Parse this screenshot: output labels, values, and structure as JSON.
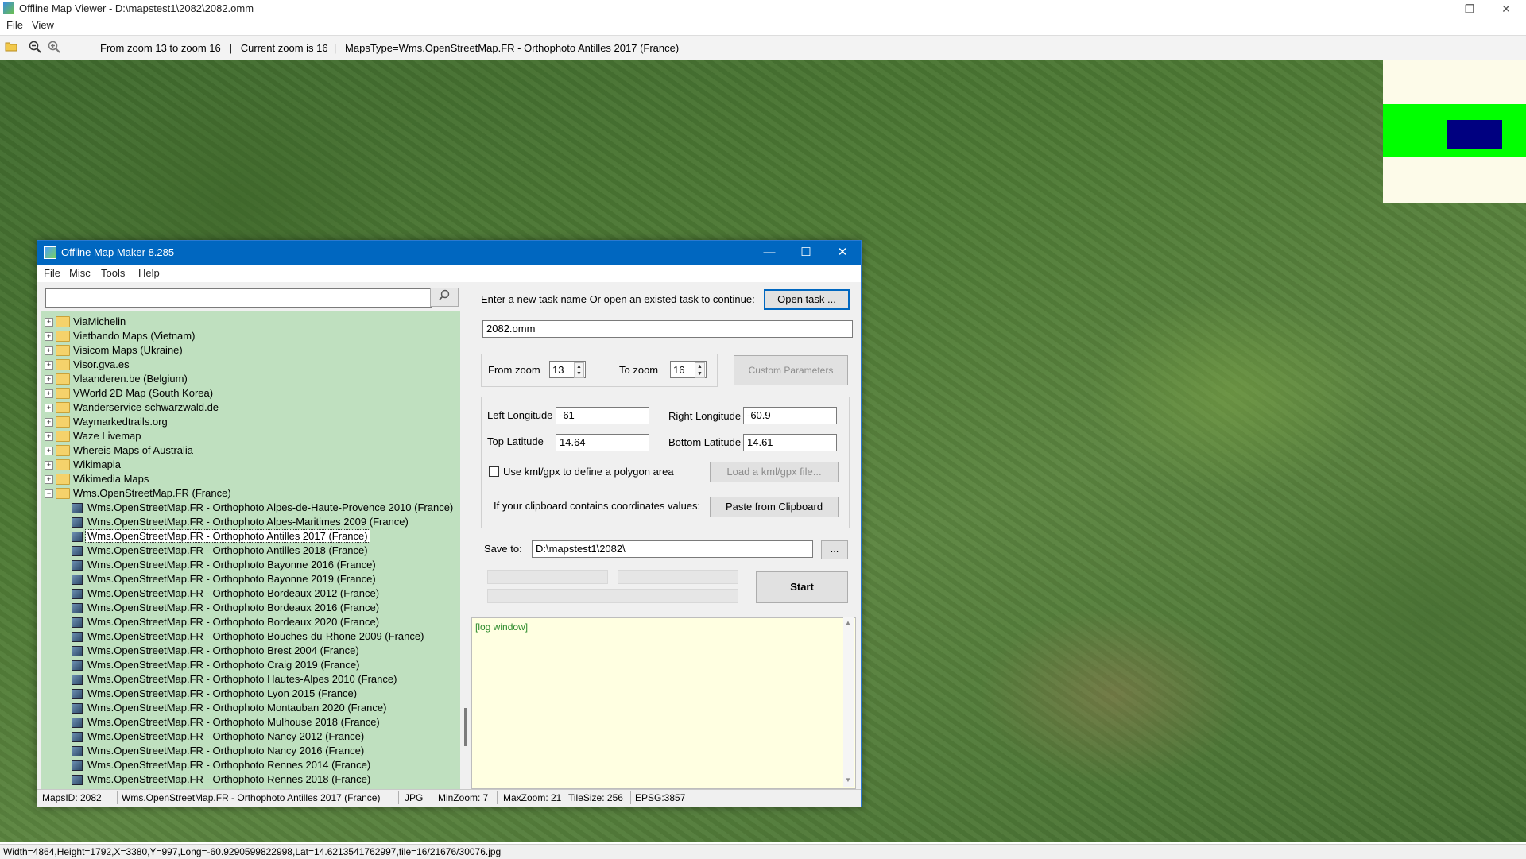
{
  "app": {
    "title": "Offline Map Viewer - D:\\mapstest1\\2082\\2082.omm",
    "menu": [
      "File",
      "View"
    ],
    "toolbar_info": "From zoom 13 to zoom 16   |   Current zoom is 16  |   MapsType=Wms.OpenStreetMap.FR - Orthophoto Antilles 2017 (France)",
    "status": "Width=4864,Height=1792,X=3380,Y=997,Long=-60.9290599822998,Lat=14.6213541762997,file=16/21676/30076.jpg",
    "overview_colors": {
      "background": "#fdfbe9",
      "band": "#00ff00",
      "viewport": "#000080"
    }
  },
  "dialog": {
    "title": "Offline Map Maker 8.285",
    "menu": [
      "File",
      "Misc",
      "Tools",
      "Help"
    ],
    "search": {
      "value": "",
      "placeholder": ""
    },
    "tree": [
      {
        "label": "ViaMichelin",
        "type": "folder",
        "level": 0,
        "expanded": false
      },
      {
        "label": "Vietbando Maps (Vietnam)",
        "type": "folder",
        "level": 0,
        "expanded": false
      },
      {
        "label": "Visicom Maps (Ukraine)",
        "type": "folder",
        "level": 0,
        "expanded": false
      },
      {
        "label": "Visor.gva.es",
        "type": "folder",
        "level": 0,
        "expanded": false
      },
      {
        "label": "Vlaanderen.be (Belgium)",
        "type": "folder",
        "level": 0,
        "expanded": false
      },
      {
        "label": "VWorld 2D Map (South Korea)",
        "type": "folder",
        "level": 0,
        "expanded": false
      },
      {
        "label": "Wanderservice-schwarzwald.de",
        "type": "folder",
        "level": 0,
        "expanded": false
      },
      {
        "label": "Waymarkedtrails.org",
        "type": "folder",
        "level": 0,
        "expanded": false
      },
      {
        "label": "Waze Livemap",
        "type": "folder",
        "level": 0,
        "expanded": false
      },
      {
        "label": "Whereis Maps of Australia",
        "type": "folder",
        "level": 0,
        "expanded": false
      },
      {
        "label": "Wikimapia",
        "type": "folder",
        "level": 0,
        "expanded": false
      },
      {
        "label": "Wikimedia Maps",
        "type": "folder",
        "level": 0,
        "expanded": false
      },
      {
        "label": "Wms.OpenStreetMap.FR (France)",
        "type": "folder",
        "level": 0,
        "expanded": true
      },
      {
        "label": "Wms.OpenStreetMap.FR - Orthophoto Alpes-de-Haute-Provence 2010 (France)",
        "type": "map",
        "level": 1
      },
      {
        "label": "Wms.OpenStreetMap.FR - Orthophoto Alpes-Maritimes 2009 (France)",
        "type": "map",
        "level": 1
      },
      {
        "label": "Wms.OpenStreetMap.FR - Orthophoto Antilles 2017 (France)",
        "type": "map",
        "level": 1,
        "selected": true
      },
      {
        "label": "Wms.OpenStreetMap.FR - Orthophoto Antilles 2018 (France)",
        "type": "map",
        "level": 1
      },
      {
        "label": "Wms.OpenStreetMap.FR - Orthophoto Bayonne 2016 (France)",
        "type": "map",
        "level": 1
      },
      {
        "label": "Wms.OpenStreetMap.FR - Orthophoto Bayonne 2019 (France)",
        "type": "map",
        "level": 1
      },
      {
        "label": "Wms.OpenStreetMap.FR - Orthophoto Bordeaux 2012 (France)",
        "type": "map",
        "level": 1
      },
      {
        "label": "Wms.OpenStreetMap.FR - Orthophoto Bordeaux 2016 (France)",
        "type": "map",
        "level": 1
      },
      {
        "label": "Wms.OpenStreetMap.FR - Orthophoto Bordeaux 2020 (France)",
        "type": "map",
        "level": 1
      },
      {
        "label": "Wms.OpenStreetMap.FR - Orthophoto Bouches-du-Rhone 2009 (France)",
        "type": "map",
        "level": 1
      },
      {
        "label": "Wms.OpenStreetMap.FR - Orthophoto Brest 2004 (France)",
        "type": "map",
        "level": 1
      },
      {
        "label": "Wms.OpenStreetMap.FR - Orthophoto Craig 2019 (France)",
        "type": "map",
        "level": 1
      },
      {
        "label": "Wms.OpenStreetMap.FR - Orthophoto Hautes-Alpes 2010 (France)",
        "type": "map",
        "level": 1
      },
      {
        "label": "Wms.OpenStreetMap.FR - Orthophoto Lyon 2015 (France)",
        "type": "map",
        "level": 1
      },
      {
        "label": "Wms.OpenStreetMap.FR - Orthophoto Montauban 2020 (France)",
        "type": "map",
        "level": 1
      },
      {
        "label": "Wms.OpenStreetMap.FR - Orthophoto Mulhouse 2018 (France)",
        "type": "map",
        "level": 1
      },
      {
        "label": "Wms.OpenStreetMap.FR - Orthophoto Nancy 2012 (France)",
        "type": "map",
        "level": 1
      },
      {
        "label": "Wms.OpenStreetMap.FR - Orthophoto Nancy 2016 (France)",
        "type": "map",
        "level": 1
      },
      {
        "label": "Wms.OpenStreetMap.FR - Orthophoto Rennes 2014 (France)",
        "type": "map",
        "level": 1
      },
      {
        "label": "Wms.OpenStreetMap.FR - Orthophoto Rennes 2018 (France)",
        "type": "map",
        "level": 1
      }
    ],
    "task": {
      "prompt": "Enter a new task name Or open an existed task to continue:",
      "open_button": "Open task ...",
      "name": "2082.omm"
    },
    "zoom": {
      "from_label": "From zoom",
      "from_value": "13",
      "to_label": "To zoom",
      "to_value": "16",
      "custom_button": "Custom Parameters"
    },
    "bounds": {
      "left_lon_label": "Left Longitude",
      "left_lon": "-61",
      "right_lon_label": "Right Longitude",
      "right_lon": "-60.9",
      "top_lat_label": "Top Latitude",
      "top_lat": "14.64",
      "bottom_lat_label": "Bottom Latitude",
      "bottom_lat": "14.61",
      "kml_checkbox_label": "Use kml/gpx to define a polygon area",
      "kml_checked": false,
      "kml_button": "Load a kml/gpx file...",
      "clipboard_prompt": "If your clipboard contains coordinates values:",
      "clipboard_button": "Paste from Clipboard"
    },
    "save": {
      "label": "Save to:",
      "path": "D:\\mapstest1\\2082\\",
      "browse_button": "..."
    },
    "start_button": "Start",
    "log": "[log window]",
    "status": {
      "maps_id": "MapsID: 2082",
      "maps_name": "Wms.OpenStreetMap.FR - Orthophoto Antilles 2017 (France)",
      "format": "JPG",
      "min_zoom": "MinZoom: 7",
      "max_zoom": "MaxZoom: 21",
      "tile_size": "TileSize: 256",
      "epsg": "EPSG:3857"
    }
  }
}
